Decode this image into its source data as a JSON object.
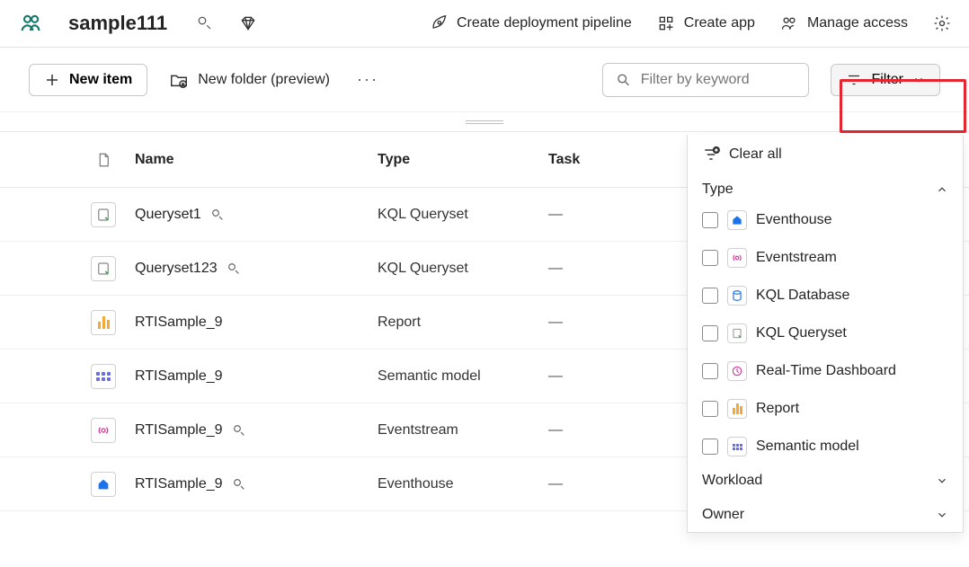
{
  "header": {
    "workspace_name": "sample111",
    "actions": {
      "create_pipeline": "Create deployment pipeline",
      "create_app": "Create app",
      "manage_access": "Manage access"
    }
  },
  "toolbar": {
    "new_item": "New item",
    "new_folder": "New folder (preview)",
    "search_placeholder": "Filter by keyword",
    "filter_label": "Filter"
  },
  "columns": {
    "name": "Name",
    "type": "Type",
    "task": "Task"
  },
  "rows": [
    {
      "icon": "queryset",
      "name": "Queryset1",
      "has_badge": true,
      "type": "KQL Queryset",
      "task": "—"
    },
    {
      "icon": "queryset",
      "name": "Queryset123",
      "has_badge": true,
      "type": "KQL Queryset",
      "task": "—"
    },
    {
      "icon": "report",
      "name": "RTISample_9",
      "has_badge": false,
      "type": "Report",
      "task": "—"
    },
    {
      "icon": "semantic",
      "name": "RTISample_9",
      "has_badge": false,
      "type": "Semantic model",
      "task": "—"
    },
    {
      "icon": "stream",
      "name": "RTISample_9",
      "has_badge": true,
      "type": "Eventstream",
      "task": "—"
    },
    {
      "icon": "eventhouse",
      "name": "RTISample_9",
      "has_badge": true,
      "type": "Eventhouse",
      "task": "—"
    }
  ],
  "filter_panel": {
    "clear_all": "Clear all",
    "sections": {
      "type": {
        "title": "Type",
        "expanded": true,
        "options": [
          {
            "label": "Eventhouse",
            "icon": "eventhouse"
          },
          {
            "label": "Eventstream",
            "icon": "stream"
          },
          {
            "label": "KQL Database",
            "icon": "kqldb"
          },
          {
            "label": "KQL Queryset",
            "icon": "queryset"
          },
          {
            "label": "Real-Time Dashboard",
            "icon": "rtdash"
          },
          {
            "label": "Report",
            "icon": "report"
          },
          {
            "label": "Semantic model",
            "icon": "semantic"
          }
        ]
      },
      "workload": {
        "title": "Workload",
        "expanded": false
      },
      "owner": {
        "title": "Owner",
        "expanded": false
      }
    }
  }
}
